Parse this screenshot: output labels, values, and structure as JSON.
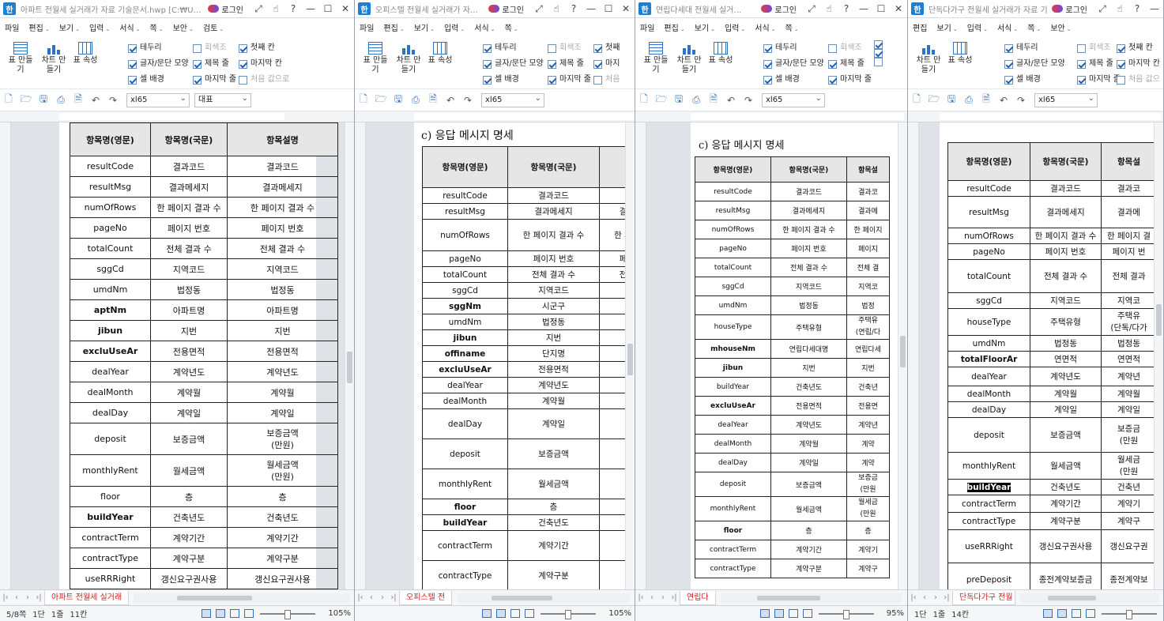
{
  "windows": [
    {
      "title": "아파트 전월세 실거래가 자료 기술문서.hwp [C:₩U…",
      "login": "로그인",
      "menus": [
        "파일",
        "편집",
        "보기",
        "입력",
        "서식",
        "쪽",
        "보안",
        "검토"
      ],
      "ribbon_buttons": [
        "표 만들기",
        "차트 만들기",
        "표 속성"
      ],
      "checkboxes": [
        [
          "테두리",
          true
        ],
        [
          "회색조",
          false
        ],
        [
          "첫째 칸",
          true
        ],
        [
          "글자/문단 모양",
          true
        ],
        [
          "제목 줄",
          true
        ],
        [
          "마지막 칸",
          true
        ],
        [
          "셀 배경",
          true
        ],
        [
          "마지막 줄",
          true
        ],
        [
          "처음 값으로",
          false
        ]
      ],
      "style_combo": "xl65",
      "font_combo": "대표",
      "section_title": "",
      "headers": [
        "항목명(영문)",
        "항목명(국문)",
        "항목설명"
      ],
      "rows": [
        [
          "resultCode",
          "결과코드",
          "결과코드",
          ""
        ],
        [
          "resultMsg",
          "결과메세지",
          "결과메세지",
          ""
        ],
        [
          "numOfRows",
          "한 페이지 결과 수",
          "한 페이지 결과 수",
          ""
        ],
        [
          "pageNo",
          "페이지 번호",
          "페이지 번호",
          ""
        ],
        [
          "totalCount",
          "전체 결과 수",
          "전체 결과 수",
          ""
        ],
        [
          "sggCd",
          "지역코드",
          "지역코드",
          ""
        ],
        [
          "umdNm",
          "법정동",
          "법정동",
          ""
        ],
        [
          "aptNm",
          "아파트명",
          "아파트명",
          "b"
        ],
        [
          "jibun",
          "지번",
          "지번",
          "b"
        ],
        [
          "excluUseAr",
          "전용면적",
          "전용면적",
          "b"
        ],
        [
          "dealYear",
          "계약년도",
          "계약년도",
          ""
        ],
        [
          "dealMonth",
          "계약월",
          "계약월",
          ""
        ],
        [
          "dealDay",
          "계약일",
          "계약일",
          ""
        ],
        [
          "deposit",
          "보증금액",
          "보증금액 (만원)",
          ""
        ],
        [
          "monthlyRent",
          "월세금액",
          "월세금액 (만원)",
          ""
        ],
        [
          "floor",
          "층",
          "층",
          ""
        ],
        [
          "buildYear",
          "건축년도",
          "건축년도",
          "b"
        ],
        [
          "contractTerm",
          "계약기간",
          "계약기간",
          ""
        ],
        [
          "contractType",
          "계약구분",
          "계약구분",
          ""
        ],
        [
          "useRRRight",
          "갱신요구권사용",
          "갱신요구권사용",
          ""
        ]
      ],
      "sheet_tab": "아파트 전월세 실거래",
      "status": {
        "page": "5/8쪽",
        "section": "1단",
        "line": "1줄",
        "col": "11칸",
        "zoom": "105%"
      }
    },
    {
      "title": "오피스텔 전월세 실거래가 자…",
      "login": "로그인",
      "menus": [
        "파일",
        "편집",
        "보기",
        "입력",
        "서식",
        "쪽"
      ],
      "ribbon_buttons": [
        "표 만들기",
        "차트 만들기",
        "표 속성"
      ],
      "checkboxes": [
        [
          "테두리",
          true
        ],
        [
          "회색조",
          false
        ],
        [
          "첫째",
          true
        ],
        [
          "글자/문단 모양",
          true
        ],
        [
          "제목 줄",
          true
        ],
        [
          "마지",
          true
        ],
        [
          "셀 배경",
          true
        ],
        [
          "마지막 줄",
          true
        ],
        [
          "처음",
          false
        ]
      ],
      "style_combo": "xl65",
      "section_title": "c) 응답 메시지 명세",
      "headers": [
        "항목명(영문)",
        "항목명(국문)",
        ""
      ],
      "rows": [
        [
          "resultCode",
          "결과코드",
          "",
          ""
        ],
        [
          "resultMsg",
          "결과메세지",
          "결",
          ""
        ],
        [
          "numOfRows",
          "한 페이지 결과 수",
          "한 페",
          ""
        ],
        [
          "pageNo",
          "페이지 번호",
          "페",
          ""
        ],
        [
          "totalCount",
          "전체 결과 수",
          "전",
          ""
        ],
        [
          "sggCd",
          "지역코드",
          "",
          ""
        ],
        [
          "sggNm",
          "시군구",
          "",
          "b"
        ],
        [
          "umdNm",
          "법정동",
          "",
          ""
        ],
        [
          "jibun",
          "지번",
          "",
          "b"
        ],
        [
          "offiname",
          "단지명",
          "",
          "b"
        ],
        [
          "excluUseAr",
          "전용면적",
          "",
          "b"
        ],
        [
          "dealYear",
          "계약년도",
          "",
          ""
        ],
        [
          "dealMonth",
          "계약월",
          "",
          ""
        ],
        [
          "dealDay",
          "계약일",
          "",
          ""
        ],
        [
          "deposit",
          "보증금액",
          "",
          ""
        ],
        [
          "monthlyRent",
          "월세금액",
          "",
          ""
        ],
        [
          "floor",
          "층",
          "",
          "b"
        ],
        [
          "buildYear",
          "건축년도",
          "",
          "b"
        ],
        [
          "contractTerm",
          "계약기간",
          "",
          ""
        ],
        [
          "contractType",
          "계약구분",
          "",
          ""
        ]
      ],
      "sheet_tab": "오피스텔 전",
      "status": {
        "zoom": "105%"
      }
    },
    {
      "title": "연립다세대 전월세 실거…",
      "login": "로그인",
      "menus": [
        "파일",
        "편집",
        "보기",
        "입력",
        "서식",
        "쪽"
      ],
      "ribbon_buttons": [
        "표 만들기",
        "차트 만들기",
        "표 속성"
      ],
      "checkboxes": [
        [
          "테두리",
          true
        ],
        [
          "회색조",
          false
        ],
        [
          "",
          true
        ],
        [
          "글자/문단 모양",
          true
        ],
        [
          "제목 줄",
          true
        ],
        [
          "",
          true
        ],
        [
          "셀 배경",
          true
        ],
        [
          "마지막 줄",
          true
        ],
        [
          "",
          false
        ]
      ],
      "style_combo": "xl65",
      "section_title": "c) 응답 메시지 명세",
      "headers": [
        "항목명(영문)",
        "항목명(국문)",
        "항목설"
      ],
      "rows": [
        [
          "resultCode",
          "결과코드",
          "결과코",
          ""
        ],
        [
          "resultMsg",
          "결과메세지",
          "결과메",
          ""
        ],
        [
          "numOfRows",
          "한 페이지 결과 수",
          "한 페이지",
          ""
        ],
        [
          "pageNo",
          "페이지 번호",
          "페이지",
          ""
        ],
        [
          "totalCount",
          "전체 결과 수",
          "전체 결",
          ""
        ],
        [
          "sggCd",
          "지역코드",
          "지역코",
          ""
        ],
        [
          "umdNm",
          "법정동",
          "법정",
          ""
        ],
        [
          "houseType",
          "주택유형",
          "주택유 (연립/다",
          ""
        ],
        [
          "mhouseNm",
          "연립다세대명",
          "연립다세",
          "b"
        ],
        [
          "jibun",
          "지번",
          "지번",
          "b"
        ],
        [
          "buildYear",
          "건축년도",
          "건축년",
          ""
        ],
        [
          "excluUseAr",
          "전용면적",
          "전용면",
          "b"
        ],
        [
          "dealYear",
          "계약년도",
          "계약년",
          ""
        ],
        [
          "dealMonth",
          "계약월",
          "계약",
          ""
        ],
        [
          "dealDay",
          "계약일",
          "계약",
          ""
        ],
        [
          "deposit",
          "보증금액",
          "보증금 (만원",
          ""
        ],
        [
          "monthlyRent",
          "월세금액",
          "월세금 (만원",
          ""
        ],
        [
          "floor",
          "층",
          "층",
          "b"
        ],
        [
          "contractTerm",
          "계약기간",
          "계약기",
          ""
        ],
        [
          "contractType",
          "계약구분",
          "계약구",
          ""
        ]
      ],
      "sheet_tab": "연립다",
      "status": {
        "zoom": "95%"
      }
    },
    {
      "title": "단독다가구 전월세 실거래가 자료 기술문…",
      "login": "로그인",
      "menus": [
        "편집",
        "보기",
        "입력",
        "서식",
        "쪽",
        "보안"
      ],
      "ribbon_buttons": [
        "차트 만들기",
        "표 속성"
      ],
      "checkboxes": [
        [
          "테두리",
          true
        ],
        [
          "회색조",
          false
        ],
        [
          "첫째 칸",
          true
        ],
        [
          "글자/문단 모양",
          true
        ],
        [
          "제목 줄",
          true
        ],
        [
          "마지막 칸",
          true
        ],
        [
          "셀 배경",
          true
        ],
        [
          "마지막 줄",
          true
        ],
        [
          "처음 값으",
          false
        ]
      ],
      "style_combo": "xl65",
      "section_title": "",
      "headers": [
        "항목명(영문)",
        "항목명(국문)",
        "항목설"
      ],
      "rows": [
        [
          "resultCode",
          "결과코드",
          "결과코",
          ""
        ],
        [
          "resultMsg",
          "결과메세지",
          "결과메",
          ""
        ],
        [
          "numOfRows",
          "한 페이지 결과 수",
          "한 페이지 결",
          ""
        ],
        [
          "pageNo",
          "페이지 번호",
          "페이지 번",
          ""
        ],
        [
          "totalCount",
          "전체 결과 수",
          "전체 결과",
          ""
        ],
        [
          "sggCd",
          "지역코드",
          "지역코",
          ""
        ],
        [
          "houseType",
          "주택유형",
          "주택유 (단독/다가",
          ""
        ],
        [
          "umdNm",
          "법정동",
          "법정동",
          ""
        ],
        [
          "totalFloorAr",
          "연면적",
          "연면적",
          "b"
        ],
        [
          "dealYear",
          "계약년도",
          "계약년",
          ""
        ],
        [
          "dealMonth",
          "계약월",
          "계약월",
          ""
        ],
        [
          "dealDay",
          "계약일",
          "계약일",
          ""
        ],
        [
          "deposit",
          "보증금액",
          "보증금 (만원",
          ""
        ],
        [
          "monthlyRent",
          "월세금액",
          "월세금 (만원",
          ""
        ],
        [
          "buildYear",
          "건축년도",
          "건축년",
          "hl"
        ],
        [
          "contractTerm",
          "계약기간",
          "계약기",
          ""
        ],
        [
          "contractType",
          "계약구분",
          "계약구",
          ""
        ],
        [
          "useRRRight",
          "갱신요구권사용",
          "갱신요구권",
          ""
        ],
        [
          "preDeposit",
          "종전계약보증금",
          "종전계약보",
          ""
        ]
      ],
      "sheet_tab": "단독다가구 전월",
      "status": {
        "section": "1단",
        "line": "1줄",
        "col": "14칸"
      }
    }
  ],
  "window_control_icons": [
    "minimize-icon",
    "maximize-icon",
    "close-icon"
  ]
}
